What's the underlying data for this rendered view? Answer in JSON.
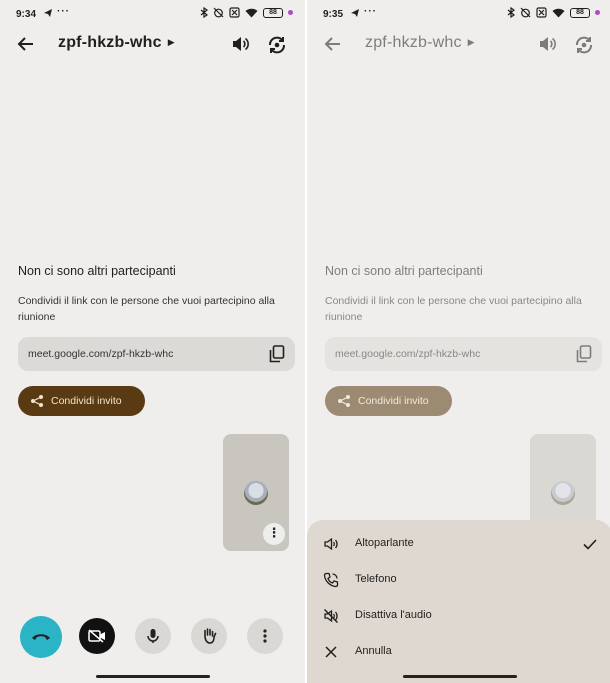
{
  "screens": [
    {
      "status": {
        "time": "9:34",
        "dots": "···",
        "battery": "88"
      },
      "meeting_code": "zpf-hkzb-whc",
      "empty_title": "Non ci sono altri partecipanti",
      "empty_subtitle": "Condividi il link con le persone che vuoi partecipino alla riunione",
      "meeting_link": "meet.google.com/zpf-hkzb-whc",
      "share_label": "Condividi invito"
    },
    {
      "status": {
        "time": "9:35",
        "dots": "···",
        "battery": "88"
      },
      "meeting_code": "zpf-hkzb-whc",
      "empty_title": "Non ci sono altri partecipanti",
      "empty_subtitle": "Condividi il link con le persone che vuoi partecipino alla riunione",
      "meeting_link": "meet.google.com/zpf-hkzb-whc",
      "share_label": "Condividi invito"
    }
  ],
  "audio_menu": {
    "items": [
      {
        "label": "Altoparlante",
        "icon": "speaker-icon",
        "selected": true
      },
      {
        "label": "Telefono",
        "icon": "phone-icon",
        "selected": false
      },
      {
        "label": "Disattiva l'audio",
        "icon": "speaker-off-icon",
        "selected": false
      },
      {
        "label": "Annulla",
        "icon": "close-icon",
        "selected": false
      }
    ]
  },
  "colors": {
    "background": "#efeeec",
    "share_button": "#5a3a12",
    "share_button_faded": "#8d7050",
    "end_call": "#2bb3c6",
    "sheet": "#dfd8d0",
    "status_dot": "#b04ac8"
  }
}
